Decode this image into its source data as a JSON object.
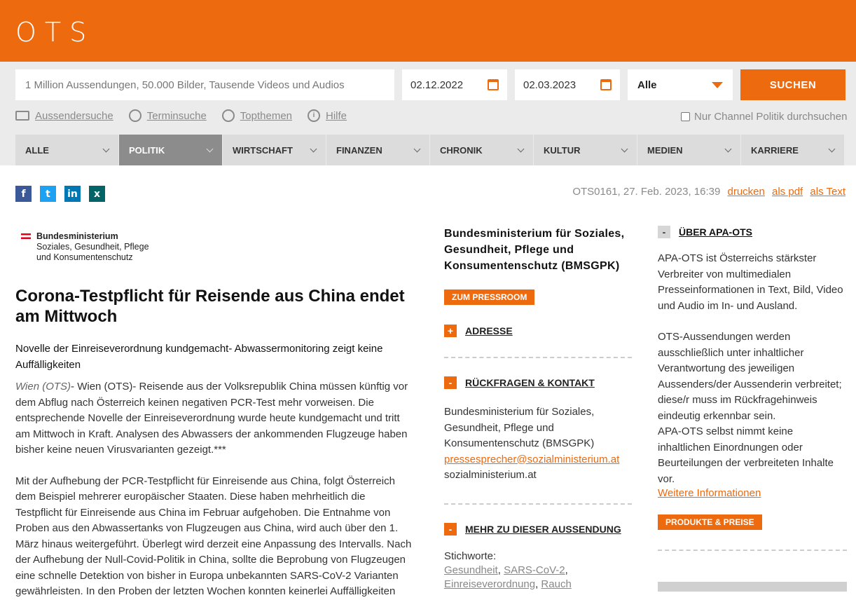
{
  "header": {
    "logo": "OTS"
  },
  "search": {
    "placeholder": "1 Million Aussendungen, 50.000 Bilder, Tausende Videos und Audios",
    "date_from": "02.12.2022",
    "date_to": "02.03.2023",
    "category_selected": "Alle",
    "submit_label": "SUCHEN",
    "links": [
      {
        "label": "Aussendersuche",
        "icon": "building-icon"
      },
      {
        "label": "Terminsuche",
        "icon": "clock-icon"
      },
      {
        "label": "Topthemen",
        "icon": "compass-icon"
      },
      {
        "label": "Hilfe",
        "icon": "info-icon"
      }
    ],
    "channel_checkbox_label": "Nur Channel Politik durchsuchen"
  },
  "nav": {
    "items": [
      {
        "label": "ALLE"
      },
      {
        "label": "POLITIK",
        "active": true
      },
      {
        "label": "WIRTSCHAFT"
      },
      {
        "label": "FINANZEN"
      },
      {
        "label": "CHRONIK"
      },
      {
        "label": "KULTUR"
      },
      {
        "label": "MEDIEN"
      },
      {
        "label": "KARRIERE"
      }
    ]
  },
  "share": {
    "icons": [
      "facebook-icon",
      "twitter-icon",
      "linkedin-icon",
      "xing-icon"
    ]
  },
  "meta": {
    "id_date": "OTS0161, 27. Feb. 2023, 16:39",
    "print": "drucken",
    "pdf": "als pdf",
    "text": "als Text"
  },
  "article": {
    "org_logo_line1": "Bundesministerium",
    "org_logo_line2": "Soziales, Gesundheit, Pflege",
    "org_logo_line3": "und Konsumentenschutz",
    "title": "Corona-Testpflicht für Reisende aus China endet am Mittwoch",
    "subtitle": "Novelle der Einreiseverordnung kundgemacht- Abwassermonitoring zeigt keine Auffälligkeiten",
    "dateline": "Wien (OTS)",
    "lead": "- Wien (OTS)- Reisende aus der Volksrepublik China müssen künftig vor dem Abflug nach Österreich keinen negativen PCR-Test mehr vorweisen. Die entsprechende Novelle der Einreiseverordnung wurde heute kundgemacht und tritt am Mittwoch in Kraft. Analysen des Abwassers der ankommenden Flugzeuge haben bisher keine neuen Virusvarianten gezeigt.***",
    "para2": "Mit der Aufhebung der PCR-Testpflicht für Einreisende aus China, folgt Österreich dem Beispiel mehrerer europäischer Staaten. Diese haben mehrheitlich die Testpflicht für Einreisende aus China im Februar aufgehoben. Die Entnahme von Proben aus den Abwassertanks von Flugzeugen aus China, wird auch über den 1. März hinaus weitergeführt. Überlegt wird derzeit eine Anpassung des Intervalls. Nach der Aufhebung der Null-Covid-Politik in China, sollte die Beprobung von Flugzeugen eine schnelle Detektion von bisher in Europa unbekannten SARS-CoV-2 Varianten gewährleisten. In den Proben der letzten Wochen konnten keinerlei Auffälligkeiten"
  },
  "sender": {
    "name": "Bundesministerium für Soziales, Gesundheit, Pflege und Konsumentenschutz (BMSGPK)",
    "pressroom_button": "ZUM PRESSROOM",
    "address_heading": "ADRESSE",
    "contact_heading": "RÜCKFRAGEN & KONTAKT",
    "contact_lines": "Bundesministerium für Soziales, Gesundheit, Pflege und Konsumentenschutz (BMSGPK)",
    "contact_email": "pressesprecher@sozialministerium.at",
    "contact_web": "sozialministerium.at",
    "more_heading": "MEHR ZU DIESER AUSSENDUNG",
    "keywords_label": "Stichworte:",
    "keywords": [
      "Gesundheit",
      "SARS-CoV-2",
      "Einreiseverordnung",
      "Rauch"
    ]
  },
  "about": {
    "heading": "ÜBER APA-OTS",
    "p1": "APA-OTS ist Österreichs stärkster Verbreiter von multimedialen Presseinformationen in Text, Bild, Video und Audio im In- und Ausland.",
    "p2": "OTS-Aussendungen werden ausschließlich unter inhaltlicher Verantwortung des jeweiligen Aussenders/der Aussenderin verbreitet; diese/r muss im Rückfragehinweis eindeutig erkennbar sein.",
    "p3": "APA-OTS selbst nimmt keine inhaltlichen Einordnungen oder Beurteilungen der verbreiteten Inhalte vor.",
    "more_link": "Weitere Informationen",
    "products_button": "PRODUKTE & PREISE"
  }
}
